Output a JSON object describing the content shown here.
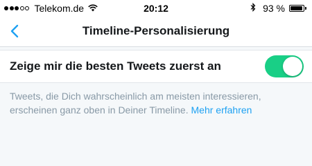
{
  "status_bar": {
    "carrier": "Telekom.de",
    "time": "20:12",
    "battery_percent": "93 %",
    "battery_level": 0.93,
    "signal_strength": 3,
    "signal_max": 5,
    "icons": [
      "wifi-icon",
      "bluetooth-icon",
      "battery-icon"
    ]
  },
  "nav": {
    "back_icon": "chevron-left-icon",
    "title": "Timeline-Personalisierung"
  },
  "setting": {
    "label": "Zeige mir die besten Tweets zuerst an",
    "enabled": true
  },
  "description": {
    "line1": "Tweets, die Dich wahrscheinlich am meisten interessieren,",
    "line2": "erscheinen ganz oben in Deiner Timeline.",
    "link": "Mehr erfahren"
  },
  "colors": {
    "accent": "#1da1f2",
    "toggle_on": "#19cf86",
    "background": "#f5f8fa",
    "description_text": "#8899a6"
  }
}
